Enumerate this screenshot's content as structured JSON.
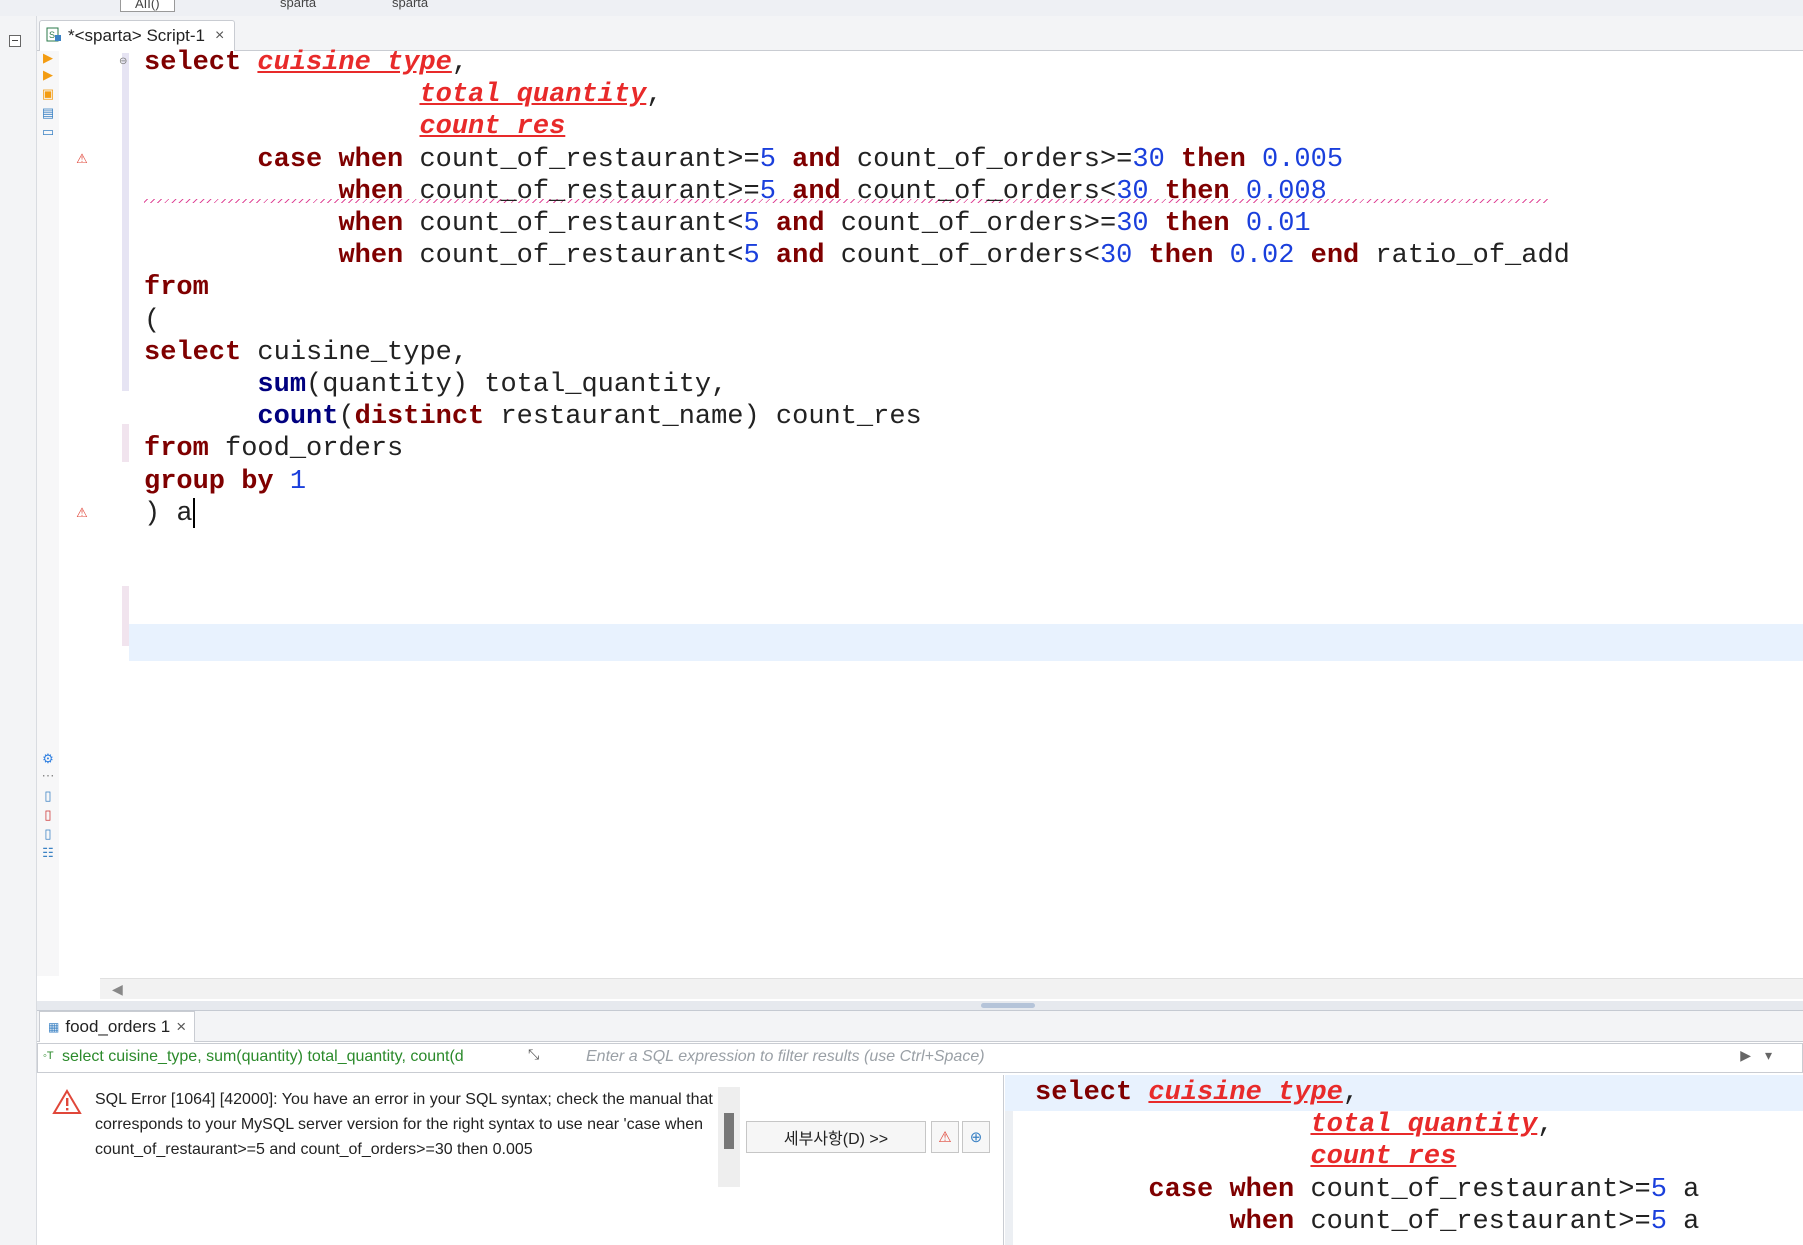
{
  "topbar": {
    "items": [
      "AII()",
      "sparta",
      "sparta"
    ]
  },
  "editor_tab": {
    "title": "*<sparta> Script-1",
    "close": "×"
  },
  "code_lines": [
    [
      {
        "t": "select",
        "c": "kw"
      },
      {
        "t": " "
      },
      {
        "t": "cuisine type",
        "c": "err"
      },
      {
        "t": ","
      }
    ],
    [
      {
        "t": "                 "
      },
      {
        "t": "total quantity",
        "c": "err"
      },
      {
        "t": ","
      }
    ],
    [
      {
        "t": "                 "
      },
      {
        "t": "count res",
        "c": "err"
      }
    ],
    [
      {
        "t": "       "
      },
      {
        "t": "case",
        "c": "kw"
      },
      {
        "t": " "
      },
      {
        "t": "when",
        "c": "kw"
      },
      {
        "t": " count_of_restaurant>="
      },
      {
        "t": "5",
        "c": "num"
      },
      {
        "t": " "
      },
      {
        "t": "and",
        "c": "kw"
      },
      {
        "t": " count_of_orders>="
      },
      {
        "t": "30",
        "c": "num"
      },
      {
        "t": " "
      },
      {
        "t": "then",
        "c": "kw"
      },
      {
        "t": " "
      },
      {
        "t": "0.005",
        "c": "num"
      }
    ],
    [
      {
        "t": "            "
      },
      {
        "t": "when",
        "c": "kw"
      },
      {
        "t": " count_of_restaurant>="
      },
      {
        "t": "5",
        "c": "num"
      },
      {
        "t": " "
      },
      {
        "t": "and",
        "c": "kw"
      },
      {
        "t": " count_of_orders<"
      },
      {
        "t": "30",
        "c": "num"
      },
      {
        "t": " "
      },
      {
        "t": "then",
        "c": "kw"
      },
      {
        "t": " "
      },
      {
        "t": "0.008",
        "c": "num"
      }
    ],
    [
      {
        "t": "            "
      },
      {
        "t": "when",
        "c": "kw"
      },
      {
        "t": " count_of_restaurant<"
      },
      {
        "t": "5",
        "c": "num"
      },
      {
        "t": " "
      },
      {
        "t": "and",
        "c": "kw"
      },
      {
        "t": " count_of_orders>="
      },
      {
        "t": "30",
        "c": "num"
      },
      {
        "t": " "
      },
      {
        "t": "then",
        "c": "kw"
      },
      {
        "t": " "
      },
      {
        "t": "0.01",
        "c": "num"
      }
    ],
    [
      {
        "t": "            "
      },
      {
        "t": "when",
        "c": "kw"
      },
      {
        "t": " count_of_restaurant<"
      },
      {
        "t": "5",
        "c": "num"
      },
      {
        "t": " "
      },
      {
        "t": "and",
        "c": "kw"
      },
      {
        "t": " count_of_orders<"
      },
      {
        "t": "30",
        "c": "num"
      },
      {
        "t": " "
      },
      {
        "t": "then",
        "c": "kw"
      },
      {
        "t": " "
      },
      {
        "t": "0.02",
        "c": "num"
      },
      {
        "t": " "
      },
      {
        "t": "end",
        "c": "kw"
      },
      {
        "t": " ratio_of_add"
      }
    ],
    [
      {
        "t": "from",
        "c": "kw"
      }
    ],
    [
      {
        "t": "("
      }
    ],
    [
      {
        "t": "select",
        "c": "kw"
      },
      {
        "t": " cuisine_type,"
      }
    ],
    [
      {
        "t": "       "
      },
      {
        "t": "sum",
        "c": "fn"
      },
      {
        "t": "(quantity) total_quantity,"
      }
    ],
    [
      {
        "t": "       "
      },
      {
        "t": "count",
        "c": "fn"
      },
      {
        "t": "("
      },
      {
        "t": "distinct",
        "c": "kw"
      },
      {
        "t": " restaurant_name) count_res"
      }
    ],
    [
      {
        "t": "from",
        "c": "kw"
      },
      {
        "t": " food_orders"
      }
    ],
    [
      {
        "t": "group by",
        "c": "kw"
      },
      {
        "t": " "
      },
      {
        "t": "1",
        "c": "num"
      }
    ],
    [
      {
        "t": ") a"
      }
    ]
  ],
  "result_tab": {
    "title": "food_orders 1",
    "close": "×"
  },
  "filter": {
    "query": "select cuisine_type, sum(quantity) total_quantity, count(d",
    "placeholder": "Enter a SQL expression to filter results (use Ctrl+Space)"
  },
  "error": {
    "message": "SQL Error [1064] [42000]: You have an error in your SQL syntax; check the manual that corresponds to your MySQL server version for the right syntax to use near 'case when count_of_restaurant>=5 and count_of_orders>=30 then 0.005",
    "details_label": "세부사항(D) >>"
  },
  "error_code_lines": [
    [
      {
        "t": "select",
        "c": "kw"
      },
      {
        "t": " "
      },
      {
        "t": "cuisine type",
        "c": "err"
      },
      {
        "t": ","
      }
    ],
    [
      {
        "t": "                 "
      },
      {
        "t": "total quantity",
        "c": "err"
      },
      {
        "t": ","
      }
    ],
    [
      {
        "t": "                 "
      },
      {
        "t": "count res",
        "c": "err"
      }
    ],
    [
      {
        "t": "       "
      },
      {
        "t": "case",
        "c": "kw"
      },
      {
        "t": " "
      },
      {
        "t": "when",
        "c": "kw"
      },
      {
        "t": " count_of_restaurant>="
      },
      {
        "t": "5",
        "c": "num"
      },
      {
        "t": " a"
      }
    ],
    [
      {
        "t": "            "
      },
      {
        "t": "when",
        "c": "kw"
      },
      {
        "t": " count_of_restaurant>="
      },
      {
        "t": "5",
        "c": "num"
      },
      {
        "t": " a"
      }
    ]
  ],
  "colors": {
    "keyword": "#7f0000",
    "function": "#00007f",
    "number": "#1a3fdc",
    "error": "#e82a2a",
    "current_line": "#e8f2fe"
  }
}
